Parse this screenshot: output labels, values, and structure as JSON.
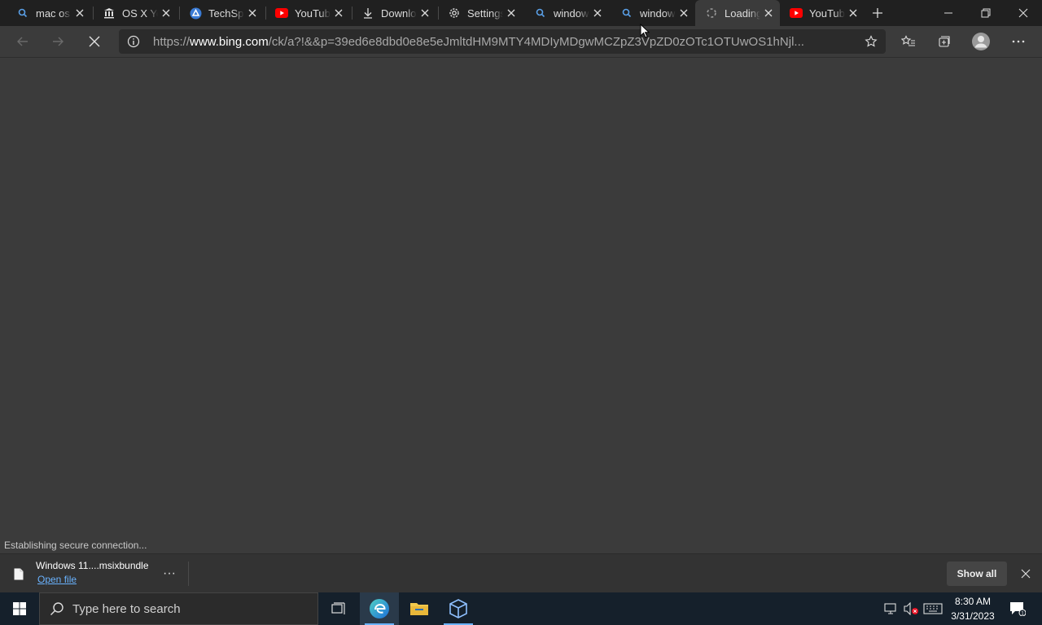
{
  "tabs": [
    {
      "title": "mac os",
      "icon": "search-icon"
    },
    {
      "title": "OS X Yo",
      "icon": "bank-icon"
    },
    {
      "title": "TechSpot",
      "icon": "techspot-icon"
    },
    {
      "title": "YouTube",
      "icon": "youtube-icon"
    },
    {
      "title": "Downloads",
      "icon": "download-icon"
    },
    {
      "title": "Settings",
      "icon": "gear-icon"
    },
    {
      "title": "windows",
      "icon": "search-icon"
    },
    {
      "title": "windows",
      "icon": "search-icon"
    },
    {
      "title": "Loading",
      "icon": "loading-icon",
      "active": true
    },
    {
      "title": "YouTube",
      "icon": "youtube-icon"
    }
  ],
  "address": {
    "prefix": "https://",
    "host": "www.bing.com",
    "path": "/ck/a?!&&p=39ed6e8dbd0e8e5eJmltdHM9MTY4MDIyMDgwMCZpZ3VpZD0zOTc1OTUwOS1hNjl..."
  },
  "status_text": "Establishing secure connection...",
  "download": {
    "file_name": "Windows 11....msixbundle",
    "open_label": "Open file",
    "more_label": "···",
    "show_all_label": "Show all"
  },
  "taskbar": {
    "search_placeholder": "Type here to search",
    "time": "8:30 AM",
    "date": "3/31/2023"
  },
  "colors": {
    "accent": "#6ab3ff",
    "youtube_red": "#ff0000",
    "page_bg": "#3b3b3b",
    "tabstrip_bg": "#202020"
  }
}
